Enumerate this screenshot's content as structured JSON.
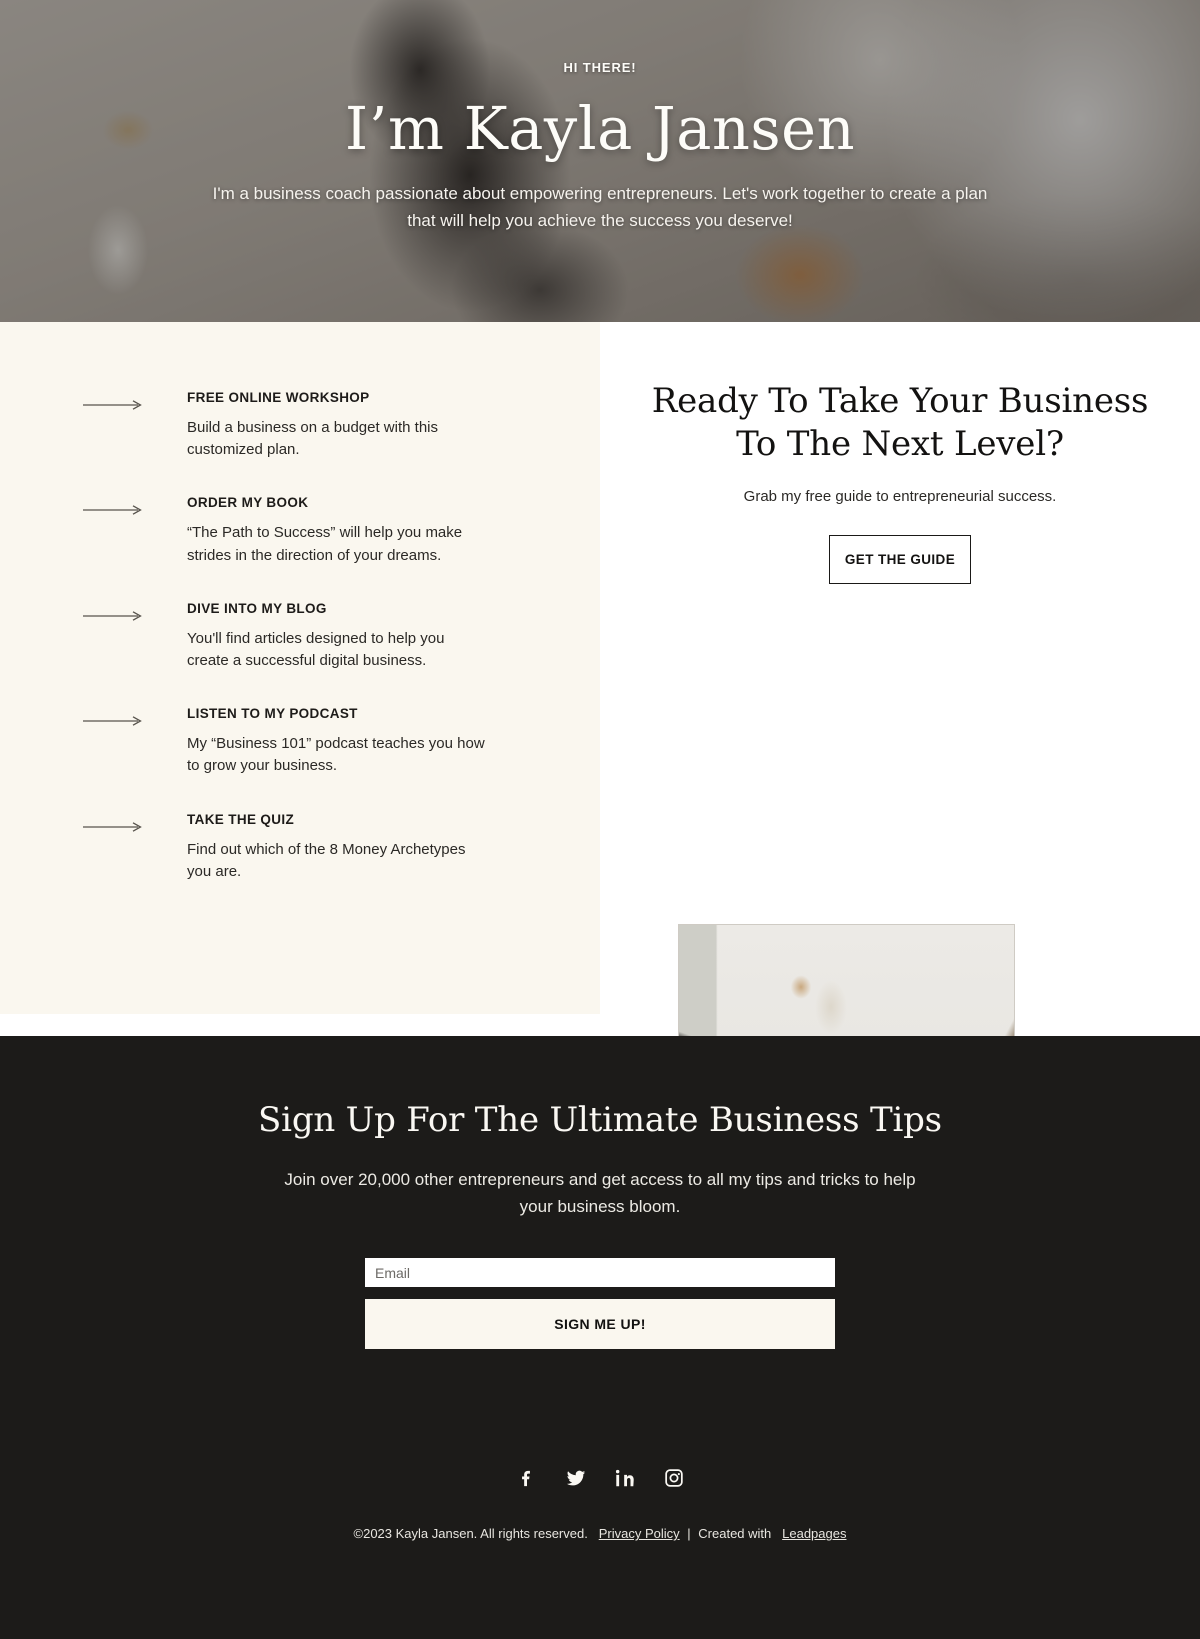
{
  "hero": {
    "eyebrow": "HI THERE!",
    "title": "I’m Kayla Jansen",
    "subtitle": "I'm a business coach passionate about empowering entrepreneurs. Let's work together to create a plan that will help you achieve the success you deserve!",
    "background_photo": "woman-at-desk-photo",
    "overlay_color": "#2c2825"
  },
  "links": [
    {
      "icon": "arrow-right-icon",
      "title": "FREE ONLINE WORKSHOP",
      "description": "Build a business on a budget with this customized plan."
    },
    {
      "icon": "arrow-right-icon",
      "title": "ORDER MY BOOK",
      "description": "“The Path to Success” will help you make strides in the direction of your dreams."
    },
    {
      "icon": "arrow-right-icon",
      "title": "DIVE INTO MY BLOG",
      "description": "You'll find articles designed to help you create a successful digital business."
    },
    {
      "icon": "arrow-right-icon",
      "title": "LISTEN TO MY PODCAST",
      "description": "My “Business 101” podcast teaches you how to grow your business."
    },
    {
      "icon": "arrow-right-icon",
      "title": "TAKE THE QUIZ",
      "description": "Find out which of the 8 Money Archetypes you are."
    }
  ],
  "cta": {
    "title": "Ready To Take Your Business To The Next Level?",
    "subtitle": "Grab my free guide to entrepreneurial success.",
    "button_label": "GET THE GUIDE",
    "photo": "woman-on-chair-with-laptop-photo"
  },
  "footer": {
    "title": "Sign Up For The Ultimate Business Tips",
    "subtitle": "Join over 20,000 other entrepreneurs and get access to all my tips and tricks to help your business bloom.",
    "email_placeholder": "Email",
    "email_value": "",
    "signup_label": "SIGN ME UP!",
    "socials": [
      {
        "name": "facebook-icon",
        "label": "Facebook"
      },
      {
        "name": "twitter-icon",
        "label": "Twitter"
      },
      {
        "name": "linkedin-icon",
        "label": "LinkedIn"
      },
      {
        "name": "instagram-icon",
        "label": "Instagram"
      }
    ],
    "copyright": "©2023 Kayla Jansen. All rights reserved.",
    "privacy_label": "Privacy Policy",
    "separator": "|",
    "created_with": "Created with",
    "platform_label": "Leadpages"
  },
  "colors": {
    "cream": "#faf7ef",
    "dark": "#1c1b19",
    "text": "#131211",
    "white": "#ffffff"
  }
}
